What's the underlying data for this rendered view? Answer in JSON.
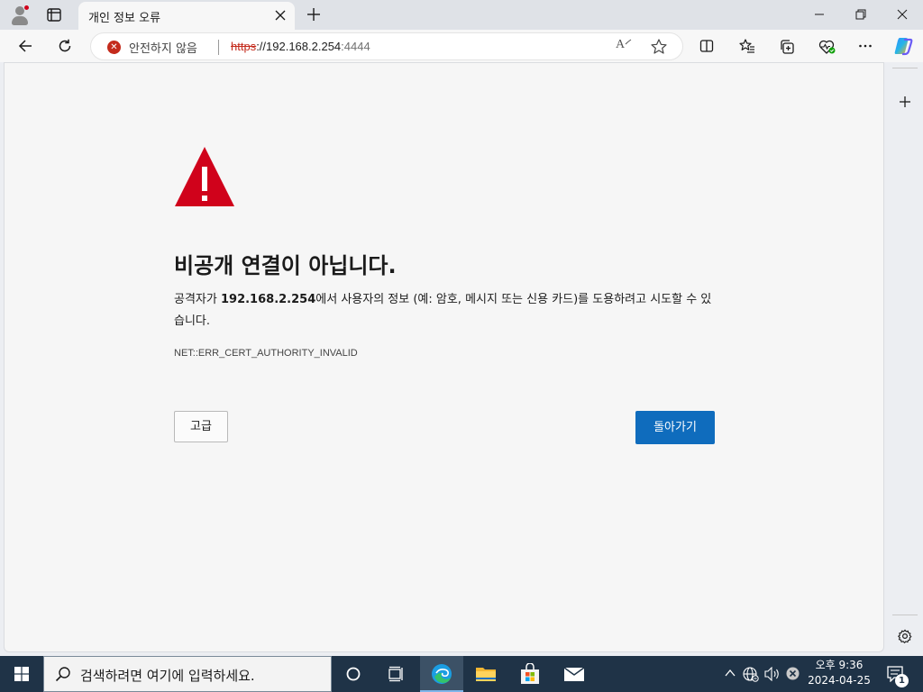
{
  "tab": {
    "title": "개인 정보 오류",
    "close_icon": "close-icon"
  },
  "address": {
    "security_label": "안전하지 않음",
    "url_scheme": "https",
    "url_rest": "://192.168.2.254",
    "url_port": ":4444",
    "read_aloud_label": "A"
  },
  "error": {
    "title": "비공개 연결이 아닙니다.",
    "desc_before": "공격자가 ",
    "host": "192.168.2.254",
    "desc_after": "에서 사용자의 정보 (예: 암호, 메시지 또는 신용 카드)를 도용하려고 시도할 수 있습니다.",
    "code": "NET::ERR_CERT_AUTHORITY_INVALID",
    "advanced_label": "고급",
    "back_label": "돌아가기"
  },
  "colors": {
    "primary_button": "#0f6cbd",
    "warning_red": "#c42b1c",
    "triangle_red": "#d0021b"
  },
  "taskbar": {
    "search_placeholder": "검색하려면 여기에 입력하세요.",
    "time": "오후 9:36",
    "date": "2024-04-25",
    "notification_count": "1"
  }
}
